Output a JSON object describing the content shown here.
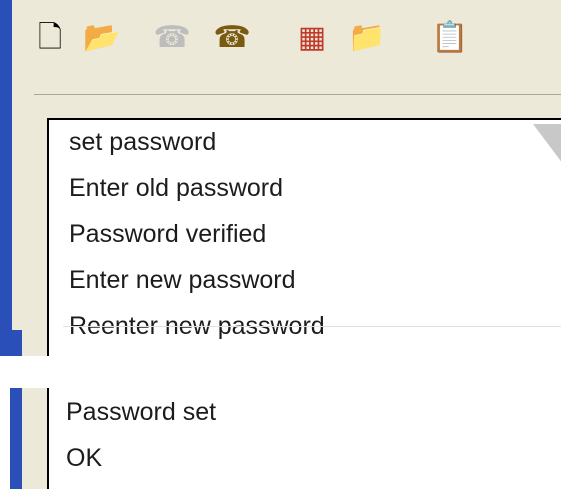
{
  "toolbar": {
    "icons": [
      {
        "name": "new-document-icon",
        "glyph": "🗋"
      },
      {
        "name": "open-folder-icon",
        "glyph": "📂"
      },
      {
        "name": "disabled-dial-icon",
        "glyph": "☎"
      },
      {
        "name": "phone-icon",
        "glyph": "☎"
      },
      {
        "name": "grid-document-icon",
        "glyph": "▦"
      },
      {
        "name": "folder-up-icon",
        "glyph": "📁"
      },
      {
        "name": "properties-icon",
        "glyph": "📋"
      }
    ]
  },
  "list": {
    "items": [
      "set password",
      "Enter old password",
      "Password verified",
      "Enter new password",
      "Reenter new password"
    ]
  },
  "bottom": {
    "items": [
      "Password set",
      "OK"
    ]
  }
}
